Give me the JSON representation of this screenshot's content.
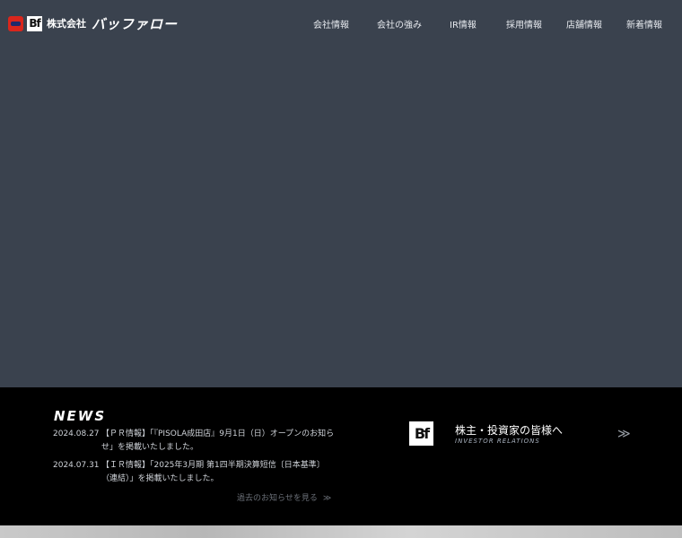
{
  "header": {
    "logo": {
      "company_prefix": "株式会社",
      "company_name": "バッファロー",
      "mark_text": "Bf"
    },
    "nav": [
      "会社情報",
      "会社の強み",
      "IR情報",
      "採用情報",
      "店舗情報",
      "新着情報"
    ]
  },
  "news": {
    "title": "NEWS",
    "items": [
      {
        "date": "2024.08.27",
        "text": "【ＰＲ情報】「『PISOLA成田店』9月1日（日）オープンのお知らせ」を掲載いたしました。"
      },
      {
        "date": "2024.07.31",
        "text": "【ＩＲ情報】「2025年3月期 第1四半期決算短信〔日本基準〕（連結）」を掲載いたしました。"
      }
    ],
    "more_label": "過去のお知らせを見る",
    "more_arrow": "≫"
  },
  "ir": {
    "logo_text": "Bf",
    "title": "株主・投資家の皆様へ",
    "subtitle": "INVESTOR RELATIONS",
    "arrow": "≫"
  },
  "colors": {
    "hero_bg": "#3a424e",
    "band_bg": "#000000",
    "logo_red": "#d9261c"
  }
}
